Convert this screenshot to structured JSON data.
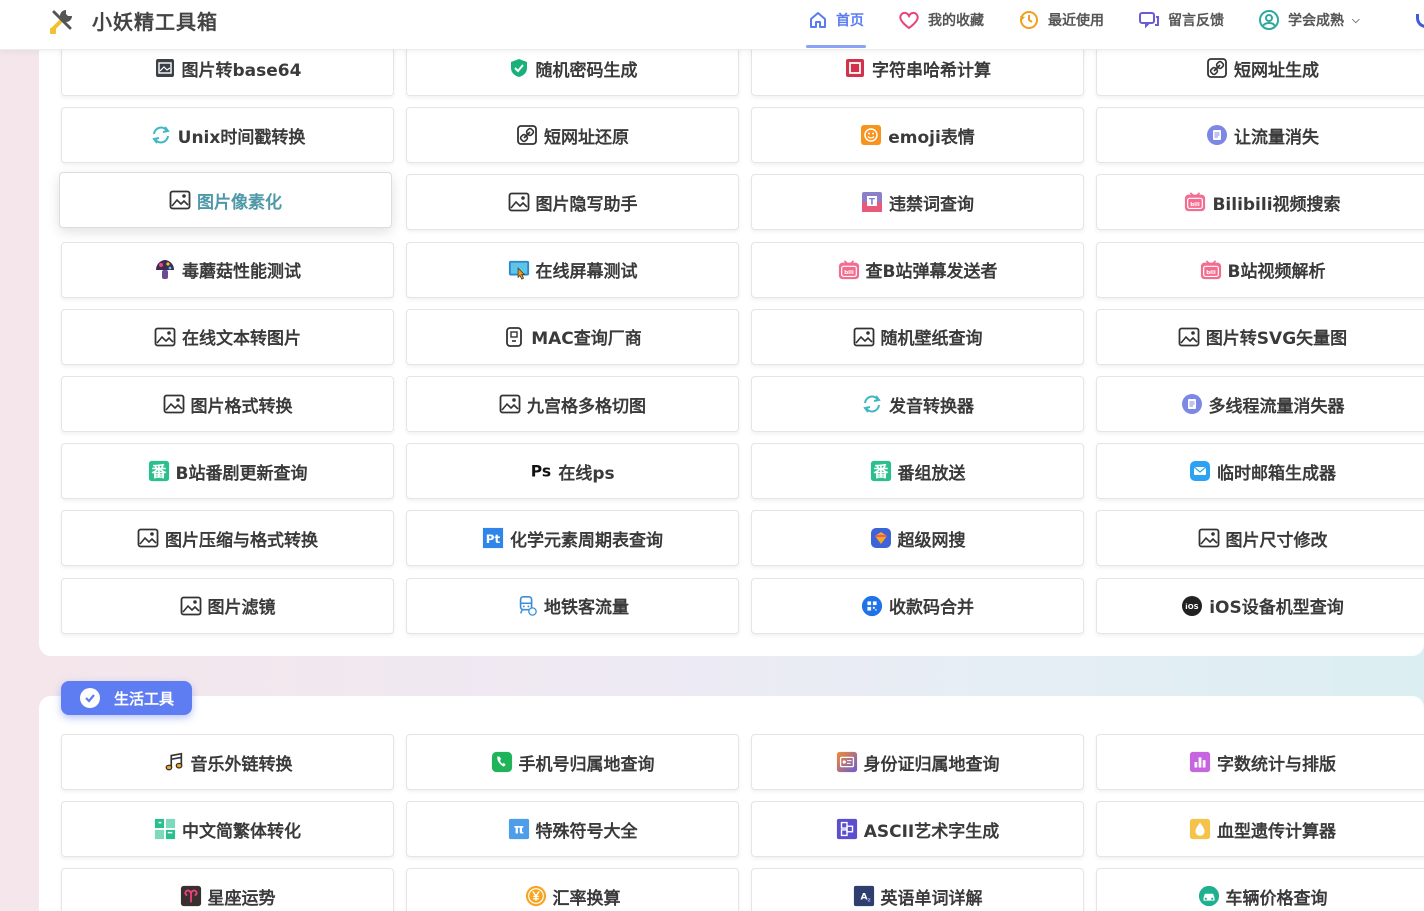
{
  "app": {
    "title": "小妖精工具箱"
  },
  "nav": [
    {
      "label": "首页",
      "icon": "home-icon",
      "active": true
    },
    {
      "label": "我的收藏",
      "icon": "heart-icon"
    },
    {
      "label": "最近使用",
      "icon": "history-icon"
    },
    {
      "label": "留言反馈",
      "icon": "chat-icon"
    },
    {
      "label": "学会成熟",
      "icon": "user-icon",
      "dropdown": true
    }
  ],
  "sections": {
    "top": {
      "rows": [
        [
          {
            "label": "图片转base64",
            "icon": "image-dark-icon"
          },
          {
            "label": "随机密码生成",
            "icon": "shield-icon"
          },
          {
            "label": "字符串哈希计算",
            "icon": "hash-icon"
          },
          {
            "label": "短网址生成",
            "icon": "link-icon"
          }
        ],
        [
          {
            "label": "Unix时间戳转换",
            "icon": "refresh-icon"
          },
          {
            "label": "短网址还原",
            "icon": "link-icon"
          },
          {
            "label": "emoji表情",
            "icon": "emoji-icon"
          },
          {
            "label": "让流量消失",
            "icon": "document-icon"
          }
        ],
        [
          {
            "label": "图片像素化",
            "icon": "image-icon"
          },
          {
            "label": "图片隐写助手",
            "icon": "image-icon"
          },
          {
            "label": "违禁词查询",
            "icon": "text-box-icon"
          },
          {
            "label": "Bilibili视频搜索",
            "icon": "bilibili-icon"
          }
        ],
        [
          {
            "label": "毒蘑菇性能测试",
            "icon": "mushroom-icon"
          },
          {
            "label": "在线屏幕测试",
            "icon": "screen-touch-icon"
          },
          {
            "label": "查B站弹幕发送者",
            "icon": "bilibili-icon"
          },
          {
            "label": "B站视频解析",
            "icon": "bilibili-icon"
          }
        ],
        [
          {
            "label": "在线文本转图片",
            "icon": "image-icon"
          },
          {
            "label": "MAC查询厂商",
            "icon": "device-icon"
          },
          {
            "label": "随机壁纸查询",
            "icon": "image-icon"
          },
          {
            "label": "图片转SVG矢量图",
            "icon": "image-icon"
          }
        ],
        [
          {
            "label": "图片格式转换",
            "icon": "image-icon"
          },
          {
            "label": "九宫格多格切图",
            "icon": "image-icon"
          },
          {
            "label": "发音转换器",
            "icon": "refresh-icon"
          },
          {
            "label": "多线程流量消失器",
            "icon": "document-icon"
          }
        ],
        [
          {
            "label": "B站番剧更新查询",
            "icon": "fan-icon"
          },
          {
            "label": "在线ps",
            "icon": "ps-icon"
          },
          {
            "label": "番组放送",
            "icon": "fan-icon"
          },
          {
            "label": "临时邮箱生成器",
            "icon": "mail-icon"
          }
        ],
        [
          {
            "label": "图片压缩与格式转换",
            "icon": "image-icon"
          },
          {
            "label": "化学元素周期表查询",
            "icon": "pt-icon"
          },
          {
            "label": "超级网搜",
            "icon": "search-app-icon"
          },
          {
            "label": "图片尺寸修改",
            "icon": "image-icon"
          }
        ],
        [
          {
            "label": "图片滤镜",
            "icon": "image-icon"
          },
          {
            "label": "地铁客流量",
            "icon": "train-icon"
          },
          {
            "label": "收款码合并",
            "icon": "qrcode-icon"
          },
          {
            "label": "iOS设备机型查询",
            "icon": "ios-icon"
          }
        ]
      ]
    },
    "life": {
      "title": "生活工具",
      "rows": [
        [
          {
            "label": "音乐外链转换",
            "icon": "music-icon"
          },
          {
            "label": "手机号归属地查询",
            "icon": "phone-icon"
          },
          {
            "label": "身份证归属地查询",
            "icon": "idcard-icon"
          },
          {
            "label": "字数统计与排版",
            "icon": "chart-icon"
          }
        ],
        [
          {
            "label": "中文简繁体转化",
            "icon": "convert-icon"
          },
          {
            "label": "特殊符号大全",
            "icon": "pi-icon"
          },
          {
            "label": "ASCII艺术字生成",
            "icon": "ascii-icon"
          },
          {
            "label": "血型遗传计算器",
            "icon": "blood-icon"
          }
        ],
        [
          {
            "label": "星座运势",
            "icon": "aries-icon"
          },
          {
            "label": "汇率换算",
            "icon": "yen-icon"
          },
          {
            "label": "英语单词详解",
            "icon": "dictionary-icon"
          },
          {
            "label": "车辆价格查询",
            "icon": "car-icon"
          }
        ]
      ]
    }
  }
}
